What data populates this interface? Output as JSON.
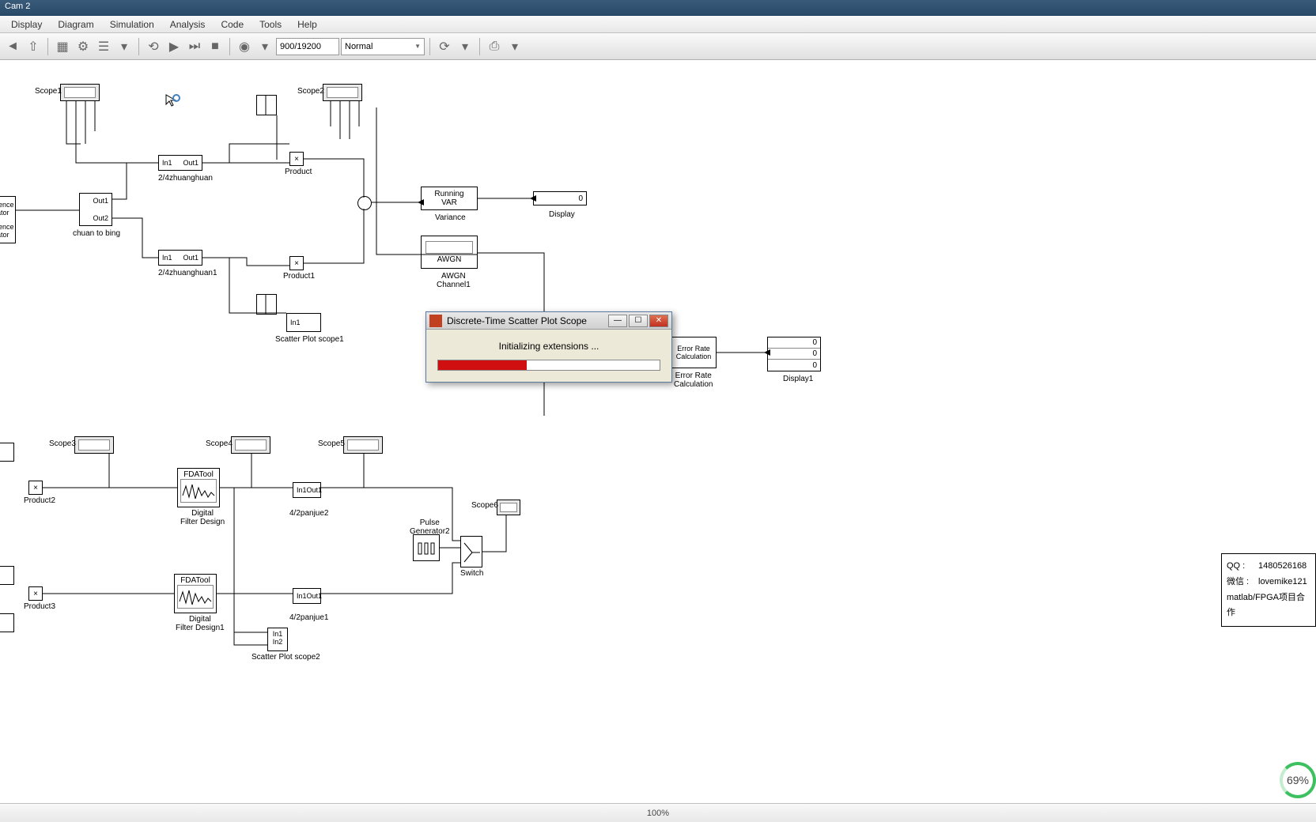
{
  "title": "Cam 2",
  "menu": [
    "Display",
    "Diagram",
    "Simulation",
    "Analysis",
    "Code",
    "Tools",
    "Help"
  ],
  "toolbar": {
    "simtime": "900/19200",
    "mode": "Normal"
  },
  "blocks": {
    "scope1": "Scope1",
    "scope2": "Scope2",
    "scope3": "Scope3",
    "scope4": "Scope4",
    "scope5": "Scope5",
    "scope6": "Scope6",
    "seqgen": {
      "line1": "uence",
      "line2": "rator",
      "line3": "uence",
      "line4": "rator"
    },
    "chuan": {
      "out1": "Out1",
      "out2": "Out2",
      "label": "chuan to bing"
    },
    "z24_1": {
      "in": "In1",
      "out": "Out1",
      "label": "2/4zhuanghuan"
    },
    "z24_2": {
      "in": "In1",
      "out": "Out1",
      "label": "2/4zhuanghuan1"
    },
    "product": "Product",
    "product1": "Product1",
    "product2": "Product2",
    "product3": "Product3",
    "runvar": {
      "l1": "Running",
      "l2": "VAR"
    },
    "variance": "Variance",
    "display": "Display",
    "display_val": "0",
    "awgn": "AWGN",
    "awgn_label": {
      "l1": "AWGN",
      "l2": "Channel1"
    },
    "scatter1": {
      "in": "In1",
      "label": "Scatter Plot scope1"
    },
    "scatter2": {
      "in1": "In1",
      "in2": "In2",
      "label": "Scatter Plot scope2"
    },
    "fda1": {
      "title": "FDATool",
      "l1": "Digital",
      "l2": "Filter Design"
    },
    "fda2": {
      "title": "FDATool",
      "l1": "Digital",
      "l2": "Filter Design1"
    },
    "panjue1": {
      "in": "In1",
      "out": "Out1",
      "label": "4/2panjue2"
    },
    "panjue2": {
      "in": "In1",
      "out": "Out1",
      "label": "4/2panjue1"
    },
    "pulse": {
      "l1": "Pulse",
      "l2": "Generator2"
    },
    "switch": "Switch",
    "errcalc": {
      "l1": "Error Rate",
      "l2": "Calculation",
      "l3": "Error Rate",
      "l4": "Calculation"
    },
    "display1": "Display1",
    "display1_vals": [
      "0",
      "0",
      "0"
    ]
  },
  "dialog": {
    "title": "Discrete-Time Scatter Plot Scope",
    "message": "Initializing extensions ..."
  },
  "status": "100%",
  "watermark": {
    "qq_label": "QQ   :",
    "qq": "1480526168",
    "wx_label": "微信 :",
    "wx": "lovemike121",
    "tag": "matlab/FPGA项目合作"
  },
  "pct": "69%"
}
